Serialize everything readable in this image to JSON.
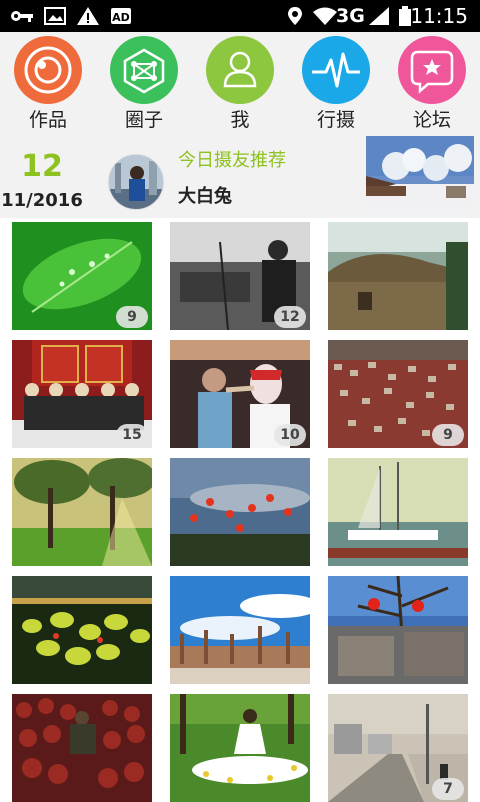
{
  "status_bar": {
    "network": "3G",
    "time": "11:15",
    "icons": [
      "key-icon",
      "image-icon",
      "warning-icon",
      "ad-icon",
      "location-icon",
      "wifi-icon",
      "signal-icon",
      "battery-icon"
    ]
  },
  "nav": {
    "items": [
      {
        "label": "作品",
        "icon": "camera-lens-icon",
        "color": "#ef6b3b"
      },
      {
        "label": "圈子",
        "icon": "network-icon",
        "color": "#3cc05c"
      },
      {
        "label": "我",
        "icon": "person-icon",
        "color": "#8dc63f"
      },
      {
        "label": "行摄",
        "icon": "pulse-icon",
        "color": "#1aa8e8"
      },
      {
        "label": "论坛",
        "icon": "star-bubble-icon",
        "color": "#f0579b"
      }
    ]
  },
  "recommend": {
    "day": "12",
    "date": "11/2016",
    "title": "今日摄友推荐",
    "user": "大白兔"
  },
  "photos": [
    {
      "count": "9"
    },
    {
      "count": "12"
    },
    {
      "count": ""
    },
    {
      "count": "15"
    },
    {
      "count": "10"
    },
    {
      "count": "9"
    },
    {
      "count": ""
    },
    {
      "count": ""
    },
    {
      "count": ""
    },
    {
      "count": ""
    },
    {
      "count": ""
    },
    {
      "count": ""
    },
    {
      "count": ""
    },
    {
      "count": ""
    },
    {
      "count": "7"
    }
  ]
}
